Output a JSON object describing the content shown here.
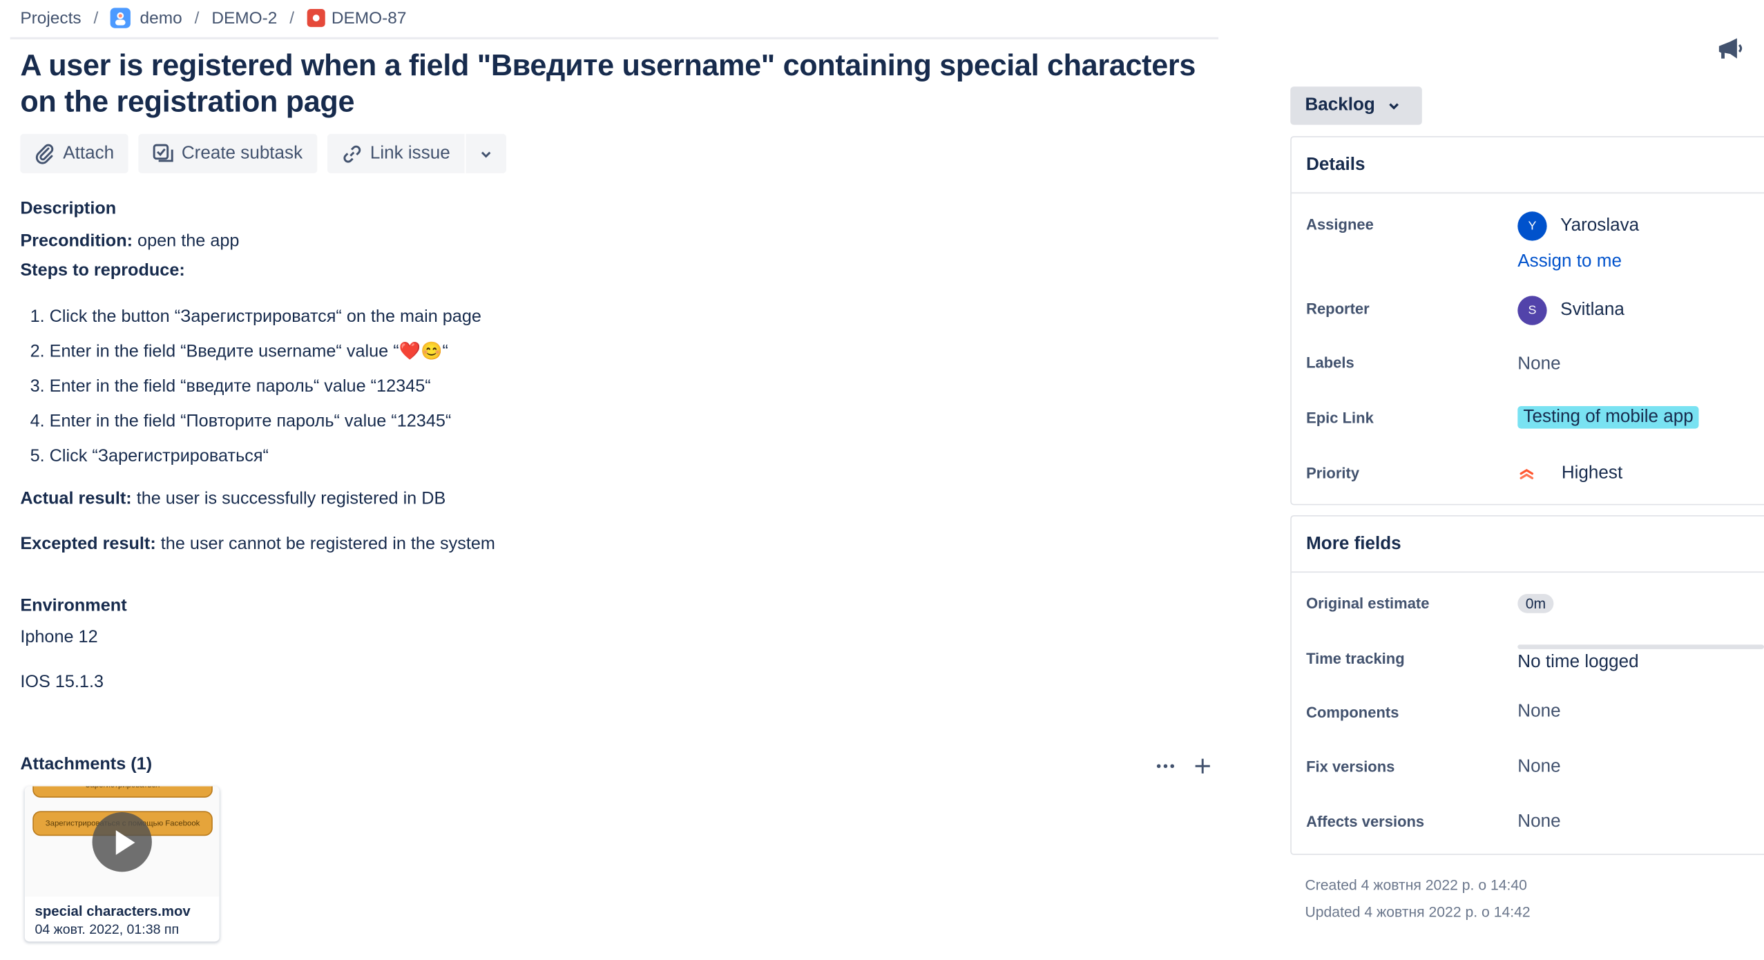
{
  "breadcrumbs": {
    "projects": "Projects",
    "project": "demo",
    "parent": "DEMO-2",
    "issue_key": "DEMO-87",
    "separator": "/"
  },
  "issue": {
    "title": "A user is registered when a field \"Введите username\" containing special characters on the registration page"
  },
  "toolbar": {
    "attach": "Attach",
    "create_subtask": "Create subtask",
    "link_issue": "Link issue"
  },
  "description": {
    "heading": "Description",
    "precondition_label": "Precondition:",
    "precondition_text": " open the app",
    "steps_label": "Steps to reproduce:",
    "steps": [
      "Click the button “Зарегистрироватся“ on the main page",
      "Enter in the field “Введите username“ value “❤️😊“",
      "Enter in the field “введите пароль“ value “12345“",
      "Enter in the field “Повторите пароль“ value “12345“",
      "Click “Зарегистрироваться“"
    ],
    "actual_label": "Actual result:",
    "actual_text": " the user is successfully registered in DB",
    "expected_label": "Excepted result:",
    "expected_text": " the user cannot be registered in the system"
  },
  "environment": {
    "heading": "Environment",
    "lines": [
      "Iphone 12",
      "IOS 15.1.3"
    ]
  },
  "attachments": {
    "heading": "Attachments (1)",
    "items": [
      {
        "name": "special characters.mov",
        "date": "04 жовт. 2022, 01:38 пп",
        "preview_top_text": "Зарегистрироваться",
        "preview_button_text": "Зарегистрироваться с помощью Facebook"
      }
    ]
  },
  "status": {
    "label": "Backlog"
  },
  "details": {
    "heading": "Details",
    "assignee_label": "Assignee",
    "assignee": {
      "name": "Yaroslava",
      "initial": "Y",
      "color": "#0052cc"
    },
    "assign_to_me": "Assign to me",
    "reporter_label": "Reporter",
    "reporter": {
      "name": "Svitlana",
      "initial": "S",
      "color": "#5243aa"
    },
    "labels_label": "Labels",
    "labels_value": "None",
    "epic_label": "Epic Link",
    "epic_value": "Testing of mobile app",
    "priority_label": "Priority",
    "priority_value": "Highest",
    "priority_color": "#ff5630"
  },
  "more_fields": {
    "heading": "More fields",
    "original_estimate_label": "Original estimate",
    "original_estimate_value": "0m",
    "time_tracking_label": "Time tracking",
    "time_tracking_value": "No time logged",
    "components_label": "Components",
    "components_value": "None",
    "fix_versions_label": "Fix versions",
    "fix_versions_value": "None",
    "affects_versions_label": "Affects versions",
    "affects_versions_value": "None"
  },
  "meta": {
    "created": "Created 4 жовтня 2022 р. о 14:40",
    "updated": "Updated 4 жовтня 2022 р. о 14:42"
  }
}
